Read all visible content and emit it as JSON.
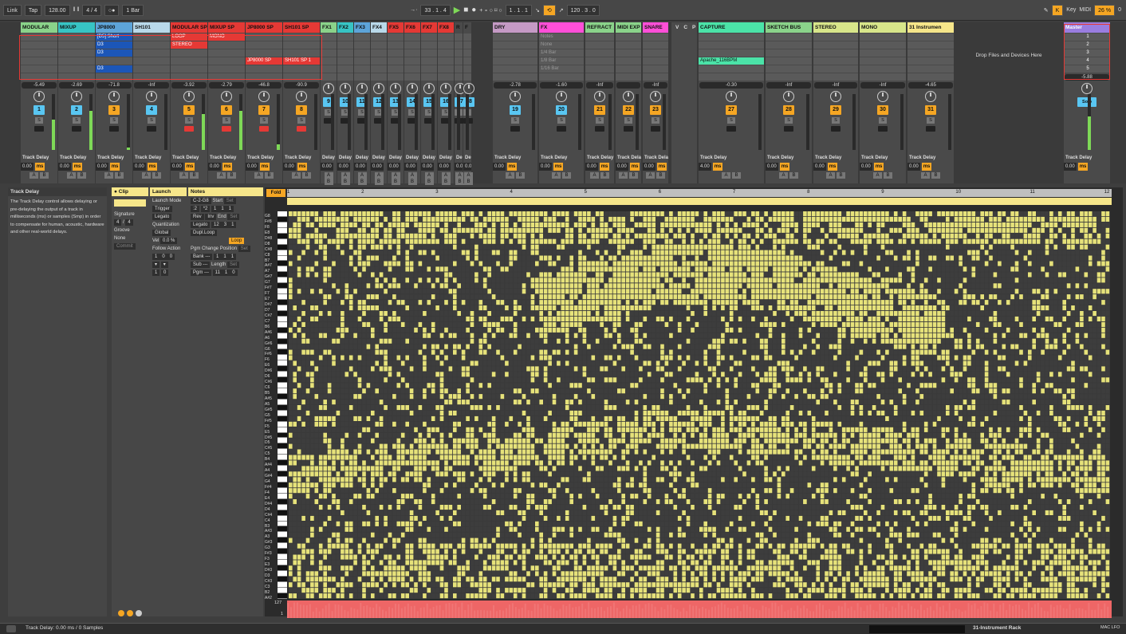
{
  "transport": {
    "link": "Link",
    "tap": "Tap",
    "tempo": "128.00",
    "sig": "4 / 4",
    "metro": "○●",
    "quant": "1 Bar",
    "pos": "33 .  1 .  4",
    "loop_start": "1 .  1 .  1",
    "loop_len": "120 .  3 .  0",
    "key": "Key",
    "midi": "MIDI",
    "cpu": "26 %",
    "cpu_zero": "0"
  },
  "tracks": [
    {
      "name": "MODULAR",
      "color": "#8ad38a",
      "vol": "-5.49",
      "num": "1",
      "numcolor": "#59c6f2",
      "clips": [
        "",
        "",
        "",
        "",
        "",
        ""
      ],
      "meter": 0.55
    },
    {
      "name": "MIXUP",
      "color": "#37c4c4",
      "vol": "-2.69",
      "num": "2",
      "numcolor": "#59c6f2",
      "clips": [
        "",
        "",
        "",
        "",
        "",
        ""
      ],
      "meter": 0.7
    },
    {
      "name": "JP8000",
      "color": "#5da4d9",
      "vol": "-71.8",
      "num": "3",
      "numcolor": "#f5a623",
      "clips": [
        "[D5] Short",
        "D3",
        "D3",
        "",
        "D3",
        ""
      ],
      "meter": 0.05
    },
    {
      "name": "SH101",
      "color": "#b9d9ea",
      "vol": "-Inf",
      "num": "4",
      "numcolor": "#59c6f2",
      "clips": [
        "",
        "",
        "",
        "",
        "",
        ""
      ],
      "meter": 0
    },
    {
      "name": "MODULAR SP",
      "color": "#e53935",
      "vol": "-3.92",
      "num": "5",
      "numcolor": "#f5a623",
      "clips": [
        "LOOP",
        "STEREO",
        "",
        "",
        "",
        ""
      ],
      "meter": 0.65
    },
    {
      "name": "MIXUP SP",
      "color": "#e53935",
      "vol": "-2.79",
      "num": "6",
      "numcolor": "#f5a623",
      "clips": [
        "MONO",
        "",
        "",
        "",
        "",
        ""
      ],
      "meter": 0.7
    },
    {
      "name": "JP8000 SP",
      "color": "#e53935",
      "vol": "-46.8",
      "num": "7",
      "numcolor": "#f5a623",
      "clips": [
        "",
        "",
        "",
        "JP8000 SP",
        "",
        ""
      ],
      "meter": 0.1
    },
    {
      "name": "SH101 SP",
      "color": "#e53935",
      "vol": "-90.9",
      "num": "8",
      "numcolor": "#f5a623",
      "clips": [
        "",
        "",
        "",
        "SH101 SP 1",
        "",
        ""
      ],
      "meter": 0
    }
  ],
  "fx_tracks": [
    {
      "name": "FX1",
      "color": "#8ad38a",
      "num": "9"
    },
    {
      "name": "FX2",
      "color": "#37c4c4",
      "num": "10"
    },
    {
      "name": "FX3",
      "color": "#5da4d9",
      "num": "11"
    },
    {
      "name": "FX4",
      "color": "#b9d9ea",
      "num": "12"
    },
    {
      "name": "FX5",
      "color": "#e53935",
      "num": "13"
    },
    {
      "name": "FX6",
      "color": "#e53935",
      "num": "14"
    },
    {
      "name": "FX7",
      "color": "#e53935",
      "num": "15"
    },
    {
      "name": "FX8",
      "color": "#e53935",
      "num": "16"
    },
    {
      "name": "R",
      "color": "#4a4a4a",
      "num": "17"
    },
    {
      "name": "F",
      "color": "#4a4a4a",
      "num": "18"
    }
  ],
  "groups": [
    {
      "name": "DRY",
      "color": "#c59ac5",
      "vol": "-2.78",
      "num": "19",
      "numcolor": "#59c6f2",
      "td": "0.00"
    },
    {
      "name": "FX",
      "color": "#ff4fd8",
      "vol": "-1.60",
      "num": "20",
      "numcolor": "#59c6f2",
      "td": "0.00",
      "slots": [
        "Notes",
        "None",
        "1/4 Bar",
        "1/8 Bar",
        "1/16 Bar"
      ]
    },
    {
      "name": "REFRACT",
      "color": "#8ad38a",
      "vol": "-Inf",
      "num": "21",
      "numcolor": "#f5a623",
      "td": "0.00"
    },
    {
      "name": "MIDI EXP",
      "color": "#8ad38a",
      "vol": "",
      "num": "22",
      "numcolor": "#f5a623",
      "td": "0.00"
    },
    {
      "name": "SNARE",
      "color": "#ff4fd8",
      "vol": "-Inf",
      "num": "23",
      "numcolor": "#f5a623",
      "td": "0.00"
    },
    {
      "name": "CAPTURE",
      "color": "#4be3a8",
      "vol": "-0.30",
      "num": "27",
      "numcolor": "#f5a623",
      "td": "4.00",
      "clip": "Apache_116BPM"
    },
    {
      "name": "SKETCH BUS",
      "color": "#8ad38a",
      "vol": "-Inf",
      "num": "28",
      "numcolor": "#f5a623",
      "td": "0.00"
    },
    {
      "name": "STEREO",
      "color": "#d8e68a",
      "vol": "-Inf",
      "num": "29",
      "numcolor": "#f5a623",
      "td": "0.00"
    },
    {
      "name": "MONO",
      "color": "#d8e68a",
      "vol": "-Inf",
      "num": "30",
      "numcolor": "#f5a623",
      "td": "0.00"
    },
    {
      "name": "31 Instrumen",
      "color": "#f6e68a",
      "vol": "-4.65",
      "num": "31",
      "numcolor": "#f5a623",
      "td": "0.00"
    }
  ],
  "vcp": [
    "V",
    "C",
    "P"
  ],
  "master": {
    "name": "Master",
    "vol": "-5.88",
    "scenes": [
      "1",
      "2",
      "3",
      "4",
      "5"
    ],
    "td": "0.00",
    "solo": "Solo"
  },
  "drop_text": "Drop Files and Devices Here",
  "labels": {
    "track_delay": "Track Delay",
    "ms": "ms",
    "a": "A",
    "b": "B",
    "s": "S",
    "delay": "Delay",
    "zero": "0.00"
  },
  "info": {
    "title": "Track Delay",
    "text": "The Track Delay control allows delaying or pre-delaying the output of a track in milliseconds (ms) or samples (Smp) in order to compensate for human, acoustic, hardware and other real-world delays."
  },
  "clip": {
    "clip_h": "Clip",
    "launch_h": "Launch",
    "notes_h": "Notes",
    "signature": "Signature",
    "sig_n": "4",
    "sig_d": "4",
    "groove": "Groove",
    "groove_val": "None",
    "commit": "Commit",
    "launch_mode": "Launch Mode",
    "trigger": "Trigger",
    "legato": "Legato",
    "quantization": "Quantization",
    "global": "Global",
    "vel": "Vel",
    "vel_val": "0.0 %",
    "follow": "Follow Action",
    "fa_vals": [
      "1",
      "0",
      "0"
    ],
    "fa2": [
      "1",
      "0"
    ],
    "range": "C-2-G8",
    "div2": ":2",
    "mul2": "*2",
    "rev": "Rev",
    "inv": "Inv",
    "legato2": "Legato",
    "dupl": "Dupl.Loop",
    "pgm_change": "Pgm Change",
    "bank": "Bank ---",
    "sub": "Sub ---",
    "pgm": "Pgm ---",
    "start": "Start",
    "start_v": [
      "1",
      "1",
      "1"
    ],
    "end": "End",
    "end_v": [
      "12",
      "3",
      "1"
    ],
    "loop": "Loop",
    "position": "Position",
    "pos_v": [
      "1",
      "1",
      "1"
    ],
    "length": "Length",
    "len_v": [
      "11",
      "1",
      "0"
    ],
    "set": "Set"
  },
  "pianoroll": {
    "fold": "Fold",
    "bars": [
      "1",
      "2",
      "3",
      "4",
      "5",
      "6",
      "7",
      "8",
      "9",
      "10",
      "11",
      "12"
    ],
    "notes": [
      "G8",
      "F#8",
      "F8",
      "E8",
      "D#8",
      "D8",
      "C#8",
      "C8",
      "B7",
      "A#7",
      "A7",
      "G#7",
      "G7",
      "F#7",
      "F7",
      "E7",
      "D#7",
      "D7",
      "C#7",
      "C7",
      "B6",
      "A#6",
      "A6",
      "G#6",
      "G6",
      "F#6",
      "F6",
      "E6",
      "D#6",
      "D6",
      "C#6",
      "C6",
      "B5",
      "A#5",
      "A5",
      "G#5",
      "G5",
      "F#5",
      "F5",
      "E5",
      "D#5",
      "D5",
      "C#5",
      "C5",
      "B4",
      "A#4",
      "A4",
      "G#4",
      "G4",
      "F#4",
      "F4",
      "E4",
      "D#4",
      "D4",
      "C#4",
      "C4",
      "B3",
      "A#3",
      "A3",
      "G#3",
      "G3",
      "F#3",
      "F3",
      "E3",
      "D#3",
      "D3",
      "C#3",
      "C3",
      "B2",
      "A#2"
    ],
    "velocity_top": "127",
    "velocity_bottom": "1",
    "note_color": "#e6e27a",
    "empty_color": "#3d3d3d"
  },
  "status": {
    "text": "Track Delay: 0.00 ms / 0 Samples",
    "rack": "31-Instrument Rack",
    "macro": "MAC LFO"
  }
}
